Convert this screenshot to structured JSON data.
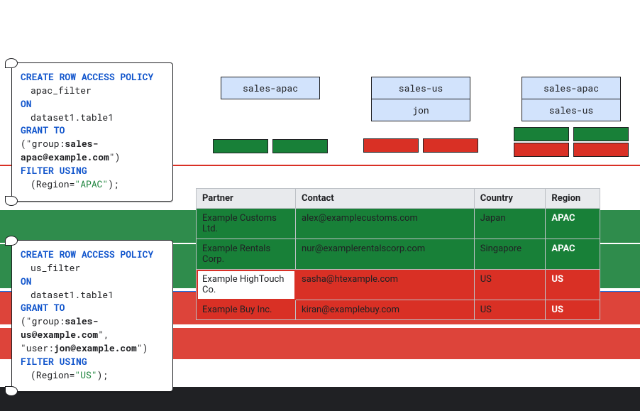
{
  "policies": [
    {
      "stmt": "CREATE ROW ACCESS POLICY",
      "name": "apac_filter",
      "on_kw": "ON",
      "target": "dataset1.table1",
      "grant_kw": "GRANT TO",
      "grantees": "(\"group:sales-apac@example.com\")",
      "grantees_bold": "sales-apac@example.com",
      "filter_kw": "FILTER USING",
      "filter_expr_prefix": "(Region=",
      "filter_value": "\"APAC\"",
      "filter_expr_suffix": ");"
    },
    {
      "stmt": "CREATE ROW ACCESS POLICY",
      "name": "us_filter",
      "on_kw": "ON",
      "target": "dataset1.table1",
      "grant_kw": "GRANT TO",
      "grantees_line1_prefix": "(\"group:",
      "grantees_line1_bold": "sales-us@example.com",
      "grantees_line1_suffix": "\",",
      "grantees_line2_prefix": " \"user:",
      "grantees_line2_bold": "jon@example.com",
      "grantees_line2_suffix": "\")",
      "filter_kw": "FILTER USING",
      "filter_expr_prefix": "(Region=",
      "filter_value": "\"US\"",
      "filter_expr_suffix": ");"
    }
  ],
  "groups": [
    {
      "labels": [
        "sales-apac"
      ],
      "mini": [
        "green",
        "green"
      ]
    },
    {
      "labels": [
        "sales-us",
        "jon"
      ],
      "mini": [
        "red",
        "red"
      ]
    },
    {
      "labels": [
        "sales-apac",
        "sales-us"
      ],
      "mini": [
        "green",
        "red"
      ]
    }
  ],
  "table": {
    "headers": [
      "Partner",
      "Contact",
      "Country",
      "Region"
    ],
    "rows": [
      {
        "partner": "Example Customs Ltd.",
        "contact": "alex@examplecustoms.com",
        "country": "Japan",
        "region": "APAC",
        "cls": "apac"
      },
      {
        "partner": "Example Rentals Corp.",
        "contact": "nur@examplerentalscorp.com",
        "country": "Singapore",
        "region": "APAC",
        "cls": "apac"
      },
      {
        "partner": "Example HighTouch Co.",
        "contact": "sasha@htexample.com",
        "country": "US",
        "region": "US",
        "cls": "us highlight"
      },
      {
        "partner": "Example Buy Inc.",
        "contact": "kiran@examplebuy.com",
        "country": "US",
        "region": "US",
        "cls": "us"
      }
    ]
  },
  "colors": {
    "apac": "#188038",
    "us": "#d93025",
    "flag": "#d2e3fc"
  }
}
